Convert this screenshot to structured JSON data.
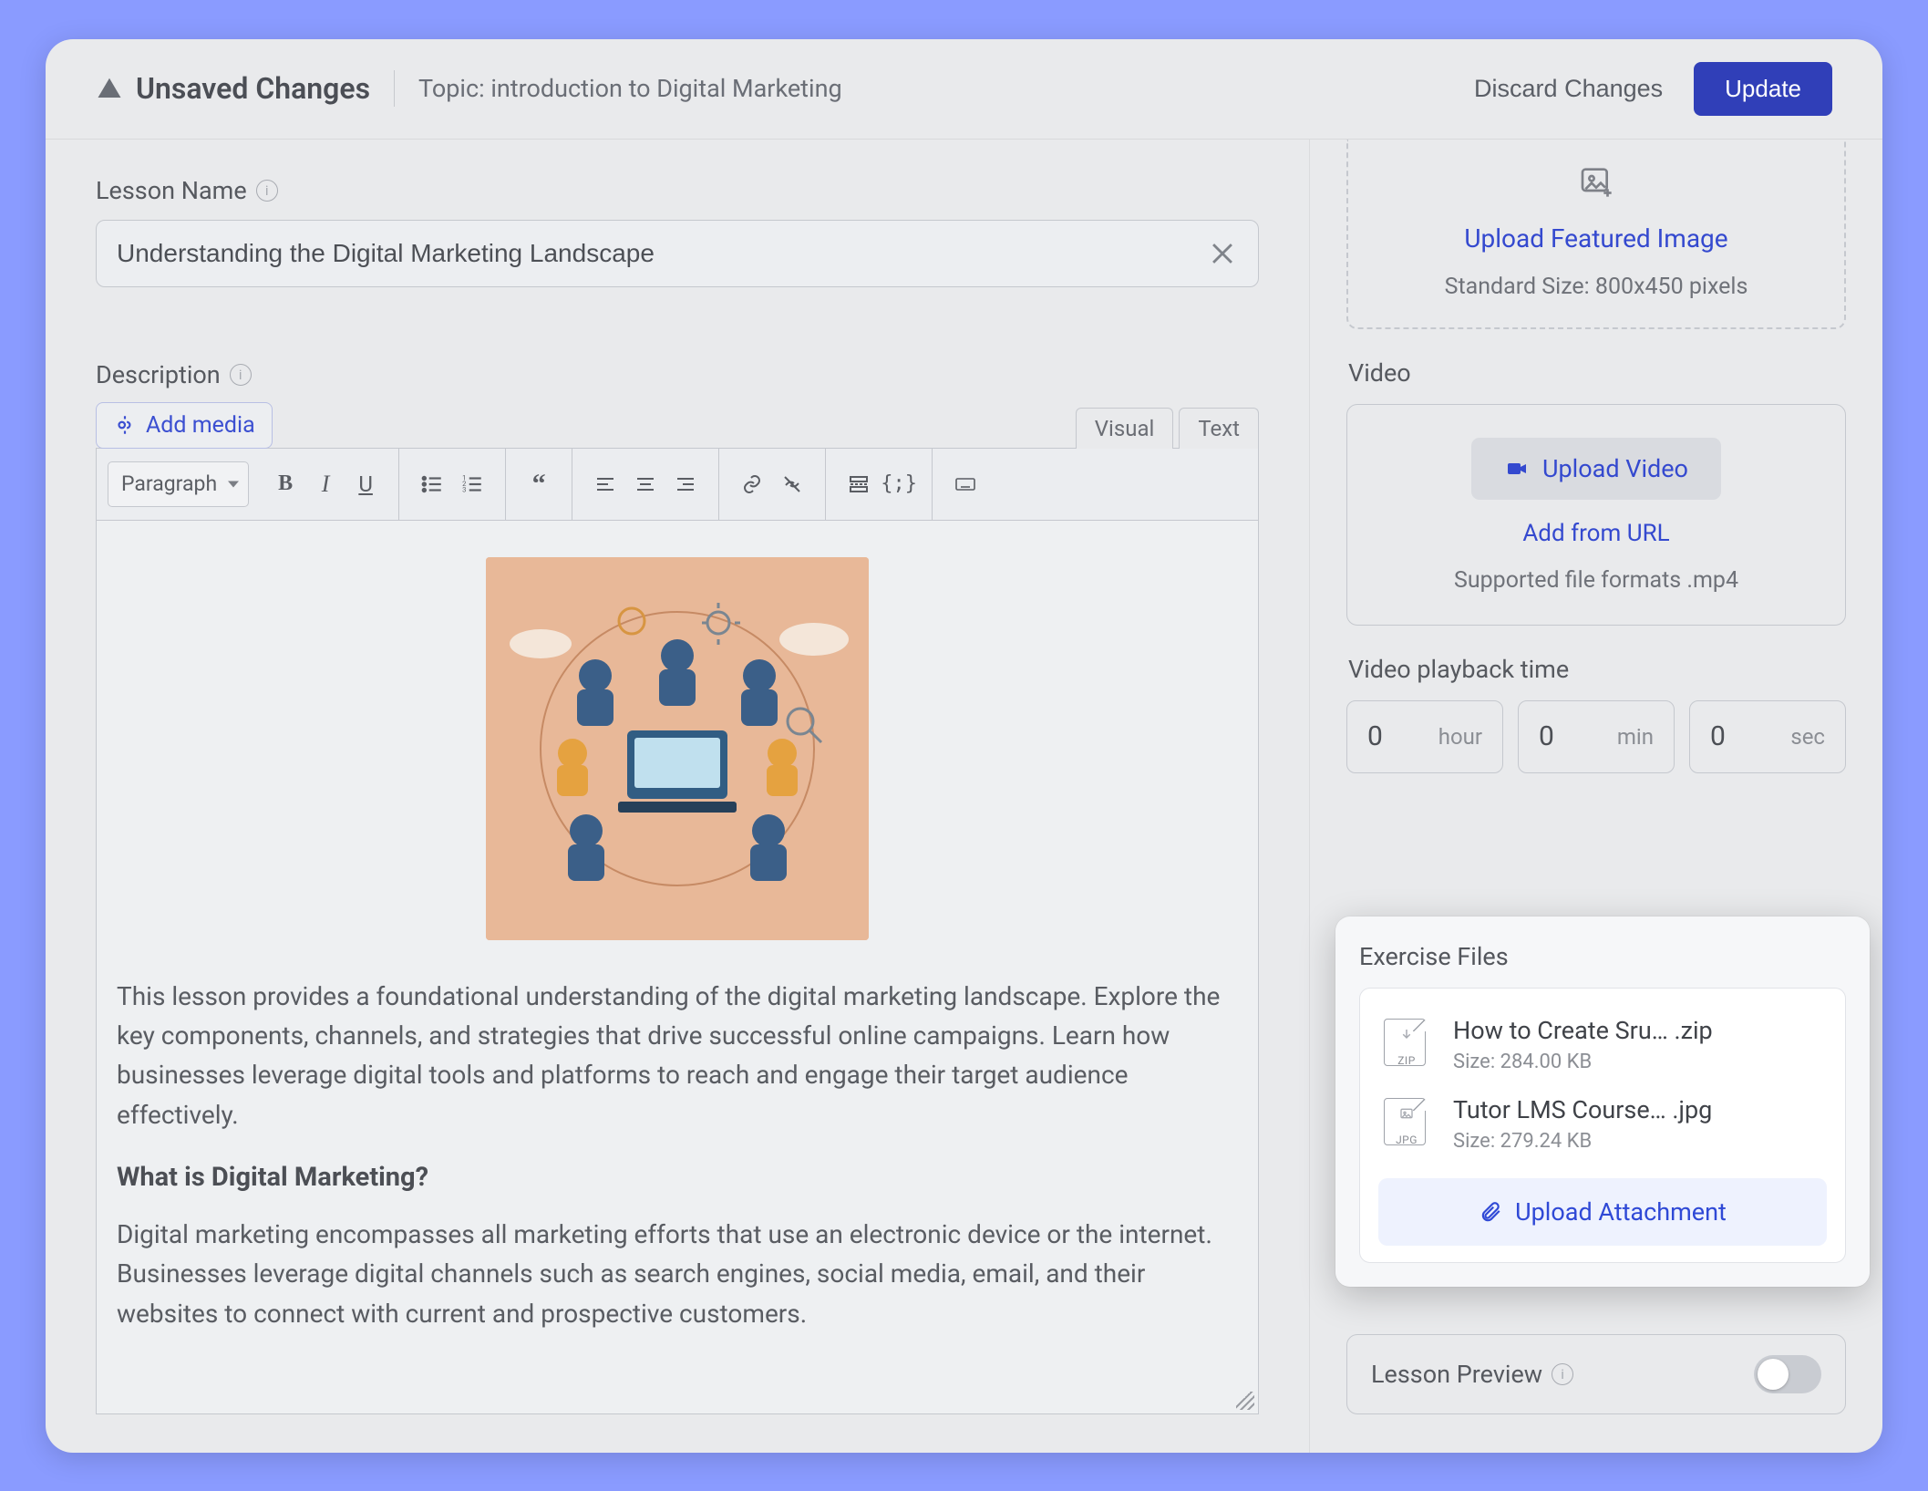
{
  "header": {
    "unsaved_label": "Unsaved Changes",
    "topic": "Topic: introduction to Digital Marketing",
    "discard": "Discard Changes",
    "update": "Update"
  },
  "lesson": {
    "name_label": "Lesson Name",
    "name_value": "Understanding the Digital Marketing Landscape",
    "desc_label": "Description",
    "add_media": "Add media",
    "tabs": {
      "visual": "Visual",
      "text": "Text"
    },
    "paragraph_select": "Paragraph",
    "body_p1": "This lesson provides a foundational understanding of the digital marketing landscape. Explore the key components, channels, and strategies that drive successful online campaigns. Learn how businesses leverage digital tools and platforms to reach and engage their target audience effectively.",
    "body_h": "What is Digital Marketing?",
    "body_p2": "Digital marketing encompasses all marketing efforts that use an electronic device or the internet. Businesses leverage digital channels such as search engines, social media, email, and their websites to connect with current and prospective customers."
  },
  "featured": {
    "link": "Upload Featured Image",
    "hint": "Standard Size: 800x450 pixels"
  },
  "video": {
    "section": "Video",
    "upload": "Upload Video",
    "add_url": "Add from URL",
    "hint": "Supported file formats .mp4"
  },
  "playback": {
    "label": "Video playback time",
    "hour": {
      "val": "0",
      "unit": "hour"
    },
    "min": {
      "val": "0",
      "unit": "min"
    },
    "sec": {
      "val": "0",
      "unit": "sec"
    }
  },
  "exercise": {
    "title": "Exercise Files",
    "files": {
      "0": {
        "name": "How to Create Sru… .zip",
        "size": "Size: 284.00 KB",
        "tag": "ZIP"
      },
      "1": {
        "name": "Tutor LMS Course… .jpg",
        "size": "Size: 279.24 KB",
        "tag": "JPG"
      }
    },
    "upload": "Upload Attachment"
  },
  "preview": {
    "label": "Lesson Preview"
  }
}
